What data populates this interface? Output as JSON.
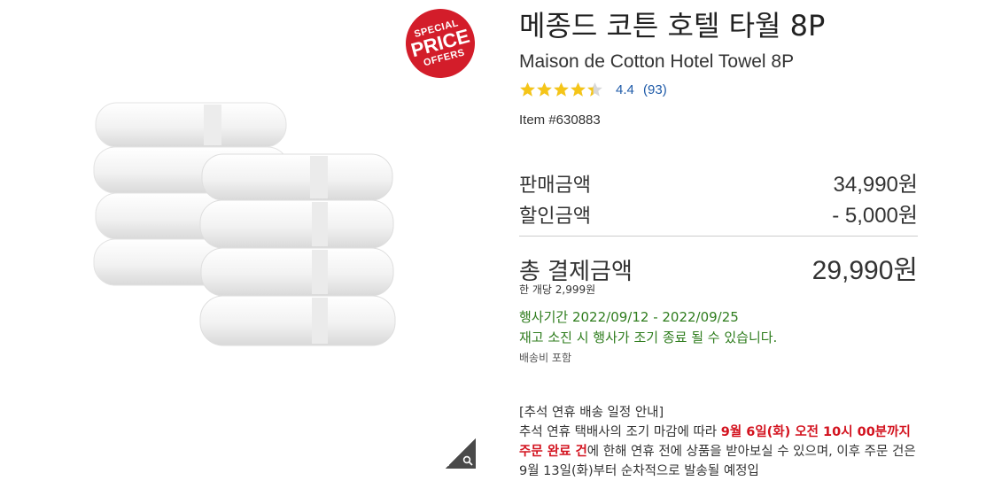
{
  "badge": {
    "line1": "SPECIAL",
    "line2": "PRICE",
    "line3": "OFFERS",
    "color": "#d31d2a"
  },
  "product": {
    "title_ko": "메종드 코튼 호텔 타월 8P",
    "title_en": "Maison de Cotton Hotel Towel 8P",
    "rating_value": "4.4",
    "review_count": "(93)",
    "rating": 4.4,
    "item_number": "Item #630883"
  },
  "pricing": {
    "sale_label": "판매금액",
    "sale_value": "34,990원",
    "discount_label": "할인금액",
    "discount_value": "- 5,000원",
    "total_label": "총 결제금액",
    "total_value": "29,990원",
    "per_unit": "한 개당 2,999원"
  },
  "promotion": {
    "period": "행사기간 2022/09/12 - 2022/09/25",
    "early_end": "재고 소진 시 행사가 조기 종료 될 수 있습니다.",
    "shipping_included": "배송비 포함"
  },
  "notice": {
    "heading": "[추석 연휴 배송 일정 안내]",
    "text_1": "추석 연휴 택배사의 조기 마감에 따라 ",
    "highlight_1": "9월 6일(화) 오전 10시 00분까지 주문 완료 건",
    "text_2": "에 한해 연휴 전에 상품을 받아보실 수 있으며, 이후 주문 건은 9월 13일(화)부터 순차적으로 발송될 예정입"
  },
  "colors": {
    "star": "#f5c518",
    "link": "#1e5aa8",
    "promo_green": "#2f7d1e",
    "notice_red": "#d3131f"
  },
  "icons": {
    "zoom": "magnifier-icon",
    "rating": "star-icon"
  }
}
